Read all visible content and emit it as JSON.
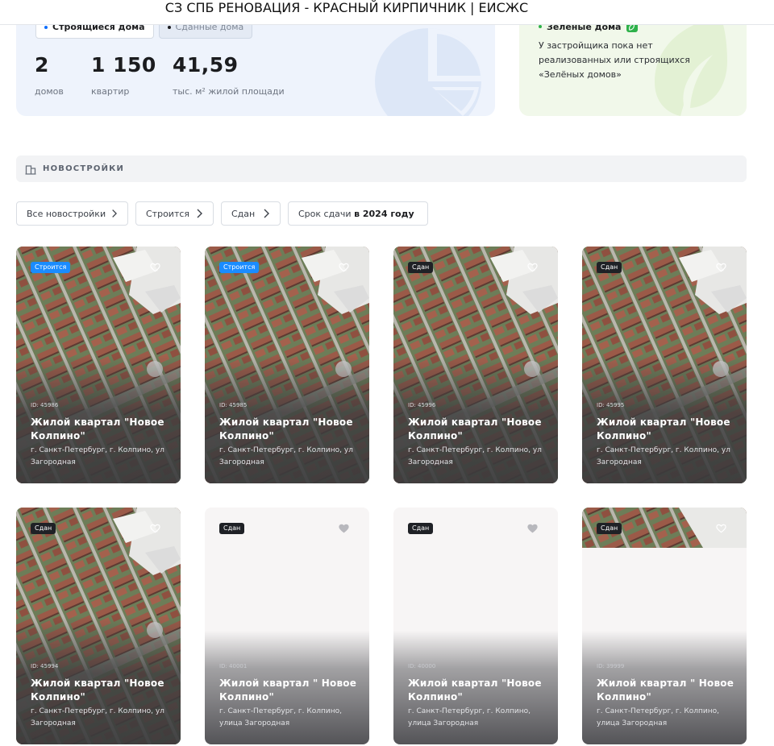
{
  "window": {
    "title": "СЗ СПБ РЕНОВАЦИЯ - КРАСНЫЙ КИРПИЧНИК | ЕИСЖС"
  },
  "stats": {
    "tabs": [
      {
        "label": "Строящиеся дома",
        "active": true
      },
      {
        "label": "Сданные дома",
        "active": false
      }
    ],
    "items": [
      {
        "value": "2",
        "label": "домов"
      },
      {
        "value": "1 150",
        "label": "квартир"
      },
      {
        "value": "41,59",
        "label": "тыс. м² жилой площади"
      }
    ]
  },
  "green": {
    "title": "Зелёные дома",
    "text": "У застройщика пока нет реализованных или строящихся «Зелёных домов»"
  },
  "section": {
    "title": "НОВОСТРОЙКИ"
  },
  "filters": [
    {
      "label": "Все новостройки",
      "bold": ""
    },
    {
      "label": "Строится",
      "bold": ""
    },
    {
      "label": "Сдан",
      "bold": ""
    },
    {
      "label": "Срок сдачи ",
      "bold": "в 2024 году"
    }
  ],
  "cards": [
    {
      "status": "Строится",
      "status_type": "building",
      "id": "ID: 45986",
      "name": "Жилой квартал \"Новое Колпино\"",
      "address": "г. Санкт-Петербург, г. Колпино, ул Загородная",
      "image": "photo"
    },
    {
      "status": "Строится",
      "status_type": "building",
      "id": "ID: 45985",
      "name": "Жилой квартал \"Новое Колпино\"",
      "address": "г. Санкт-Петербург, г. Колпино, ул Загородная",
      "image": "photo"
    },
    {
      "status": "Сдан",
      "status_type": "done",
      "id": "ID: 45996",
      "name": "Жилой квартал \"Новое Колпино\"",
      "address": "г. Санкт-Петербург, г. Колпино, ул Загородная",
      "image": "photo"
    },
    {
      "status": "Сдан",
      "status_type": "done",
      "id": "ID: 45995",
      "name": "Жилой квартал \"Новое Колпино\"",
      "address": "г. Санкт-Петербург, г. Колпино, ул Загородная",
      "image": "photo"
    },
    {
      "status": "Сдан",
      "status_type": "done",
      "id": "ID: 45994",
      "name": "Жилой квартал \"Новое Колпино\"",
      "address": "г. Санкт-Петербург, г. Колпино, ул Загородная",
      "image": "photo"
    },
    {
      "status": "Сдан",
      "status_type": "done",
      "id": "ID: 40001",
      "name": "Жилой квартал \" Новое Колпино\"",
      "address": "г. Санкт-Петербург, г. Колпино, улица Загородная",
      "image": "blank"
    },
    {
      "status": "Сдан",
      "status_type": "done",
      "id": "ID: 40000",
      "name": "Жилой квартал \"Новое Колпино\"",
      "address": "г. Санкт-Петербург, г. Колпино, улица Загородная",
      "image": "blank"
    },
    {
      "status": "Сдан",
      "status_type": "done",
      "id": "ID: 39999",
      "name": "Жилой квартал \" Новое Колпино\"",
      "address": "г. Санкт-Петербург, г. Колпино, улица Загородная",
      "image": "partial"
    }
  ],
  "icons": {
    "heart": "heart-icon",
    "chevron": "chevron-right-icon",
    "building": "building-icon",
    "leaf": "leaf-icon",
    "pie": "pie-chart-icon"
  },
  "colors": {
    "accent_blue": "#1a8cff",
    "green": "#2eb14a",
    "stats_bg": "#eef3fc",
    "green_bg": "#f1f8ea"
  }
}
